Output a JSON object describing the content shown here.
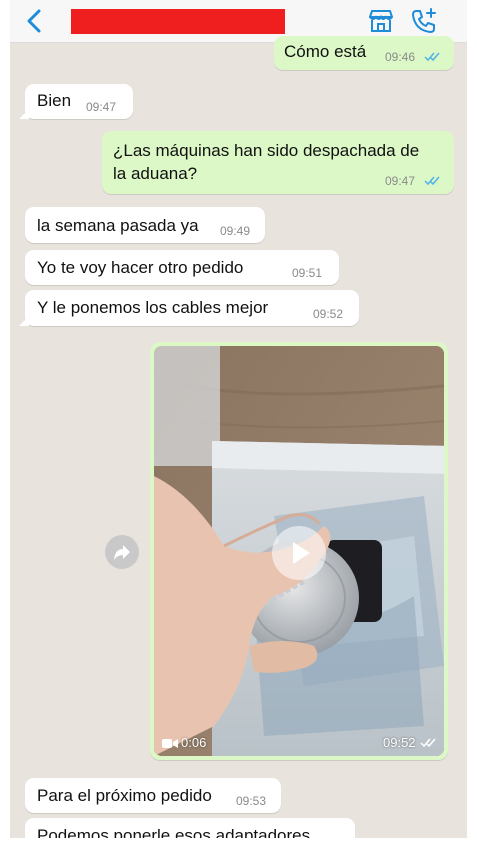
{
  "header": {
    "back_label": "‹",
    "icons": [
      "back-icon",
      "store-icon",
      "add-call-icon"
    ]
  },
  "messages": [
    {
      "direction": "out",
      "text": "Cómo está",
      "time": "09:46",
      "ticks": "read"
    },
    {
      "direction": "in",
      "text": "Bien",
      "time": "09:47"
    },
    {
      "direction": "out",
      "text_line1": "¿Las máquinas han sido despachada de",
      "text_line2": "la aduana?",
      "time": "09:47",
      "ticks": "read"
    },
    {
      "direction": "in",
      "text": "la semana pasada ya",
      "time": "09:49"
    },
    {
      "direction": "in",
      "text": "Yo te voy hacer otro pedido",
      "time": "09:51"
    },
    {
      "direction": "in",
      "text": "Y le ponemos los cables mejor",
      "time": "09:52"
    },
    {
      "direction": "in",
      "text": "Para el próximo pedido",
      "time": "09:53"
    },
    {
      "direction": "in",
      "text": "Podemos ponerle esos adaptadores"
    }
  ],
  "video_message": {
    "direction": "out",
    "duration": "0:06",
    "time": "09:52",
    "icons": [
      "video-camera-icon",
      "play-icon",
      "forward-icon"
    ]
  },
  "colors": {
    "accent": "#1f8cd9",
    "outgoing_bubble": "#dcf8c6",
    "incoming_bubble": "#ffffff",
    "chat_background": "#e8e4dd",
    "redaction": "#ef1f1f",
    "read_ticks": "#4fb3e8"
  }
}
